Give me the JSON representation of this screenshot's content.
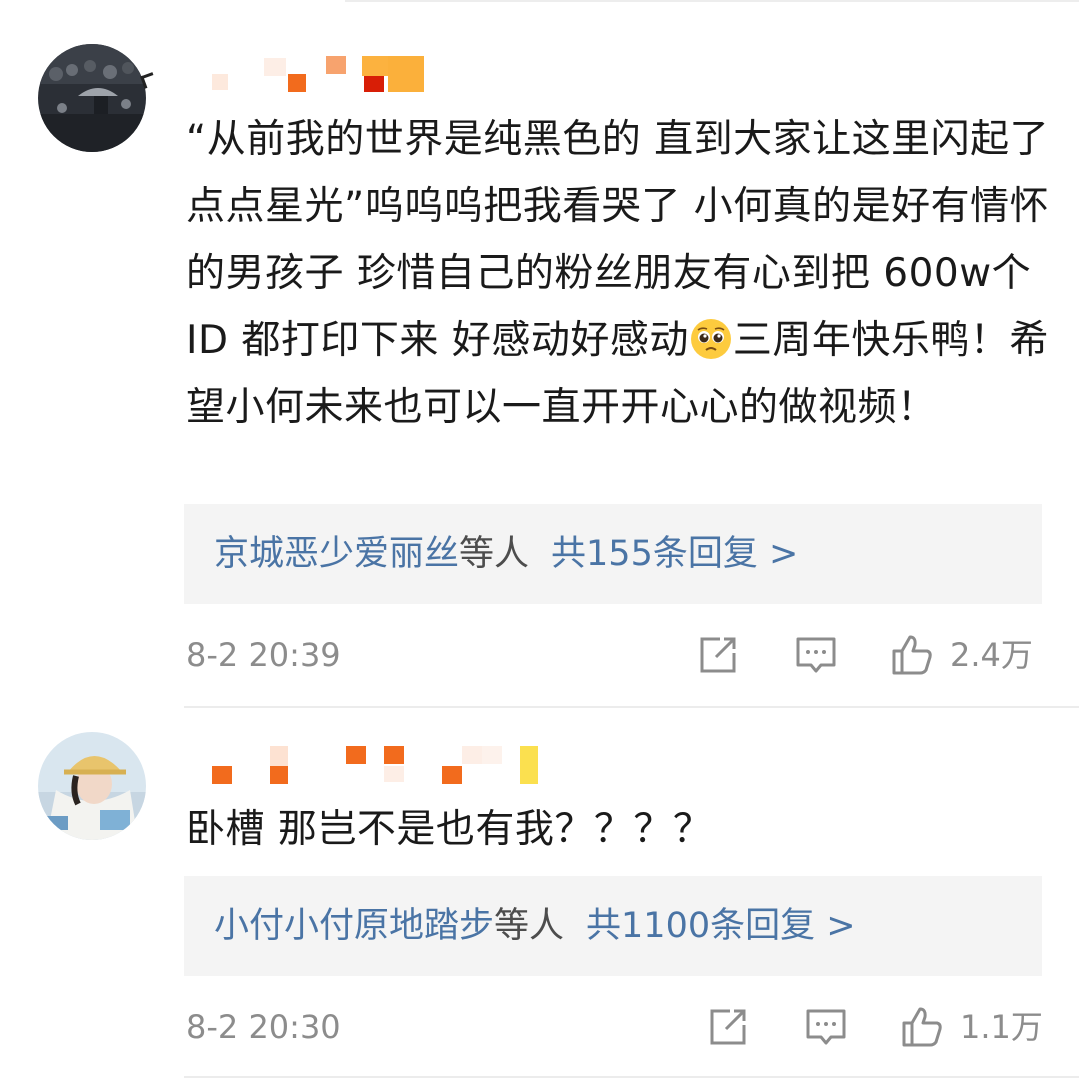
{
  "comments": [
    {
      "text": "“从前我的世界是纯黑色的 直到大家让这里闪起了点点星光”呜呜呜把我看哭了 小何真的是好有情怀的男孩子 珍惜自己的粉丝朋友有心到把 600w个 ID 都打印下来 好感动好感动",
      "text_after_emoji": "三周年快乐鸭！希望小何未来也可以一直开开心心的做视频！",
      "emoji_icon": "pleading-face-emoji",
      "reply_user": "京城恶少爱丽丝",
      "reply_etc": "等人",
      "reply_count": "共155条回复 >",
      "timestamp": "8-2 20:39",
      "likes": "2.4万",
      "icons": [
        "share-icon",
        "reply-icon",
        "like-icon"
      ]
    },
    {
      "text": "卧槽 那岂不是也有我？？？？",
      "reply_user": "小付小付原地踏步",
      "reply_etc": "等人",
      "reply_count": "共1100条回复 >",
      "timestamp": "8-2 20:30",
      "likes": "1.1万",
      "icons": [
        "share-icon",
        "reply-icon",
        "like-icon"
      ]
    }
  ],
  "colors": {
    "link_blue": "#4a74a5",
    "meta_gray": "#8c8c8c",
    "reply_bg": "#f4f4f4",
    "mosaic_orange": "#f26b1d",
    "mosaic_yellow": "#fbb03b",
    "mosaic_red": "#d81e06"
  }
}
